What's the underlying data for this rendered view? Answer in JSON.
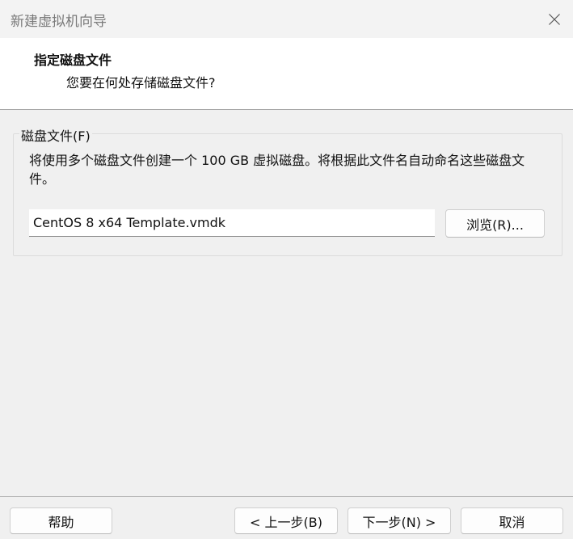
{
  "window": {
    "title": "新建虚拟机向导",
    "close_icon": "close-icon"
  },
  "header": {
    "title": "指定磁盘文件",
    "subtitle": "您要在何处存储磁盘文件?"
  },
  "disk_file_group": {
    "legend": "磁盘文件(F)",
    "description": "将使用多个磁盘文件创建一个 100 GB 虚拟磁盘。将根据此文件名自动命名这些磁盘文件。",
    "file_name_value": "CentOS 8 x64 Template.vmdk",
    "browse_label": "浏览(R)..."
  },
  "footer": {
    "help_label": "帮助",
    "back_label": "< 上一步(B)",
    "next_label": "下一步(N) >",
    "cancel_label": "取消"
  }
}
